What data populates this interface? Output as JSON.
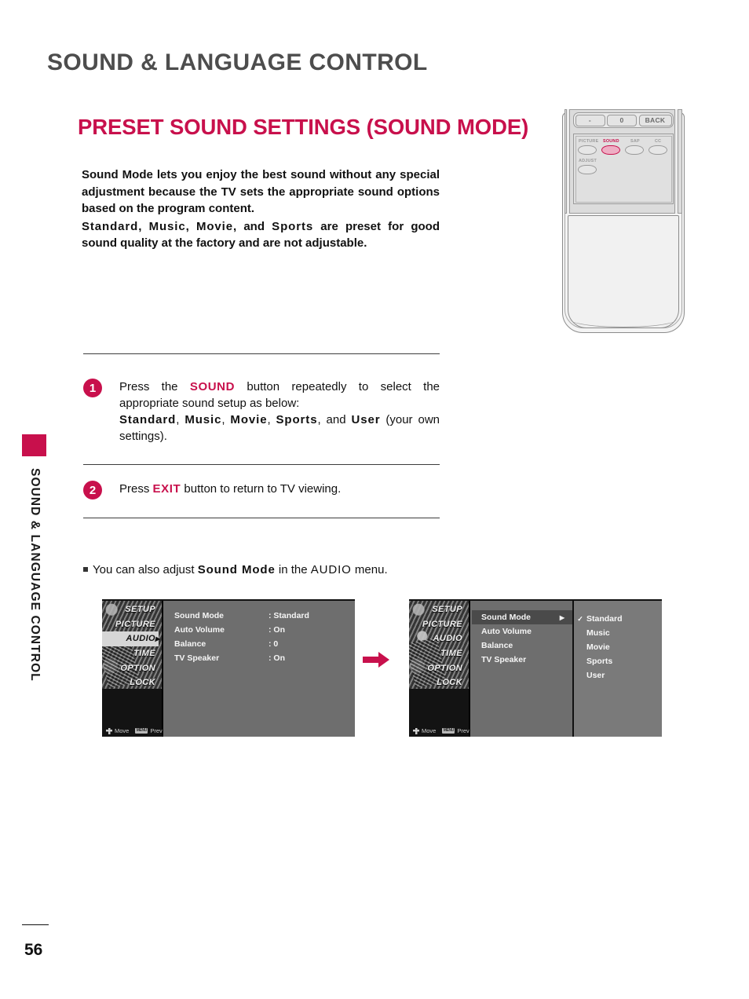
{
  "chapter": {
    "title": "SOUND & LANGUAGE CONTROL",
    "running_head": "SOUND & LANGUAGE CONTROL"
  },
  "section": {
    "title": "PRESET SOUND SETTINGS (SOUND MODE)"
  },
  "intro": {
    "paragraph1": "Sound Mode lets you enjoy the best sound without any special adjustment because the TV sets the appropriate sound options based on the program content.",
    "p2_kw1": "Standard",
    "p2_sep1": ", ",
    "p2_kw2": "Music",
    "p2_sep2": ", ",
    "p2_kw3": "Movie",
    "p2_sep3": ", and ",
    "p2_kw4": "Sports",
    "p2_tail": " are preset for good sound quality at the factory and are not adjustable."
  },
  "remote": {
    "num_keys": [
      "-",
      "0",
      "BACK"
    ],
    "fn_buttons": [
      {
        "label": "PICTURE",
        "highlight": false
      },
      {
        "label": "SOUND",
        "highlight": true
      },
      {
        "label": "SAP",
        "highlight": false
      },
      {
        "label": "CC",
        "highlight": false
      },
      {
        "label": "ADJUST",
        "highlight": false
      }
    ],
    "highlight_color": "#C8104C"
  },
  "steps": [
    {
      "number": "1",
      "line1_pre": "Press the ",
      "line1_accent": "SOUND",
      "line1_post": " button repeatedly to select the appropriate sound setup as below:",
      "kw1": "Standard",
      "sep1": ", ",
      "kw2": "Music",
      "sep2": ", ",
      "kw3": "Movie",
      "sep3": ", ",
      "kw4": "Sports",
      "sep4": ", and ",
      "kw5": "User",
      "tail": "  (your own settings)."
    },
    {
      "number": "2",
      "line1_pre": "Press ",
      "line1_accent": "EXIT",
      "line1_post": " button to return to TV viewing."
    }
  ],
  "note": {
    "pre": "You can also adjust ",
    "kw": "Sound Mode",
    "mid": " in the ",
    "kw2": "AUDIO",
    "post": " menu."
  },
  "osd": {
    "nav_items": [
      "SETUP",
      "PICTURE",
      "AUDIO",
      "TIME",
      "OPTION",
      "LOCK"
    ],
    "hint_move": "Move",
    "hint_prev": "Prev",
    "hint_prev_icon": "MENU",
    "left": {
      "selected_nav": "AUDIO",
      "rows": [
        {
          "label": "Sound Mode",
          "value": ": Standard"
        },
        {
          "label": "Auto Volume",
          "value": ": On"
        },
        {
          "label": "Balance",
          "value": ": 0"
        },
        {
          "label": "TV Speaker",
          "value": ": On"
        }
      ]
    },
    "right": {
      "selected_nav": "",
      "rows": [
        {
          "label": "Sound Mode",
          "selected": true,
          "arrow": "▶"
        },
        {
          "label": "Auto Volume",
          "selected": false,
          "arrow": ""
        },
        {
          "label": "Balance",
          "selected": false,
          "arrow": ""
        },
        {
          "label": "TV Speaker",
          "selected": false,
          "arrow": ""
        }
      ],
      "submenu": [
        {
          "label": "Standard",
          "checked": true
        },
        {
          "label": "Music",
          "checked": false
        },
        {
          "label": "Movie",
          "checked": false
        },
        {
          "label": "Sports",
          "checked": false
        },
        {
          "label": "User",
          "checked": false
        }
      ],
      "check_glyph": "✓"
    }
  },
  "footer": {
    "page_number": "56"
  },
  "colors": {
    "accent": "#C8104C",
    "chapter_title": "#4D4D4D",
    "osd_background": "#6E6E6E",
    "osd_nav_background": "#131313"
  }
}
